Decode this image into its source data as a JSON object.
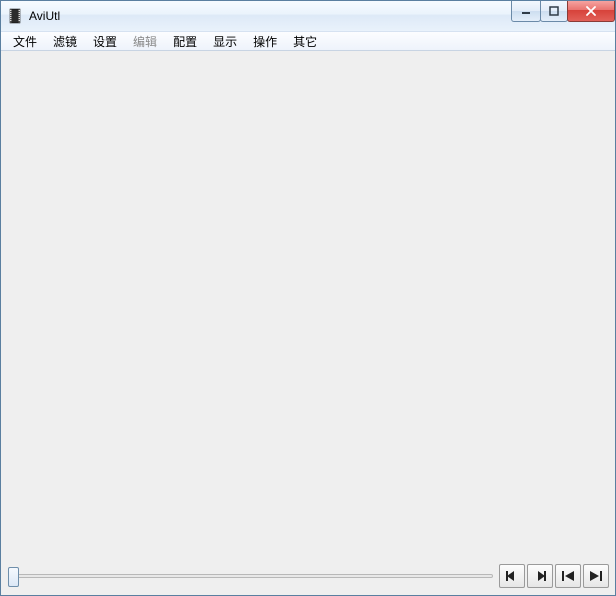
{
  "window": {
    "title": "AviUtl"
  },
  "menu": {
    "items": [
      {
        "label": "文件",
        "disabled": false
      },
      {
        "label": "滤镜",
        "disabled": false
      },
      {
        "label": "设置",
        "disabled": false
      },
      {
        "label": "编辑",
        "disabled": true
      },
      {
        "label": "配置",
        "disabled": false
      },
      {
        "label": "显示",
        "disabled": false
      },
      {
        "label": "操作",
        "disabled": false
      },
      {
        "label": "其它",
        "disabled": false
      }
    ]
  },
  "playback": {
    "position": 0
  },
  "icons": {
    "app": "app-icon",
    "minimize": "minimize-icon",
    "maximize": "maximize-icon",
    "close": "close-icon",
    "prev_frame": "step-back-icon",
    "next_frame": "step-forward-icon",
    "to_start": "skip-start-icon",
    "to_end": "skip-end-icon"
  }
}
